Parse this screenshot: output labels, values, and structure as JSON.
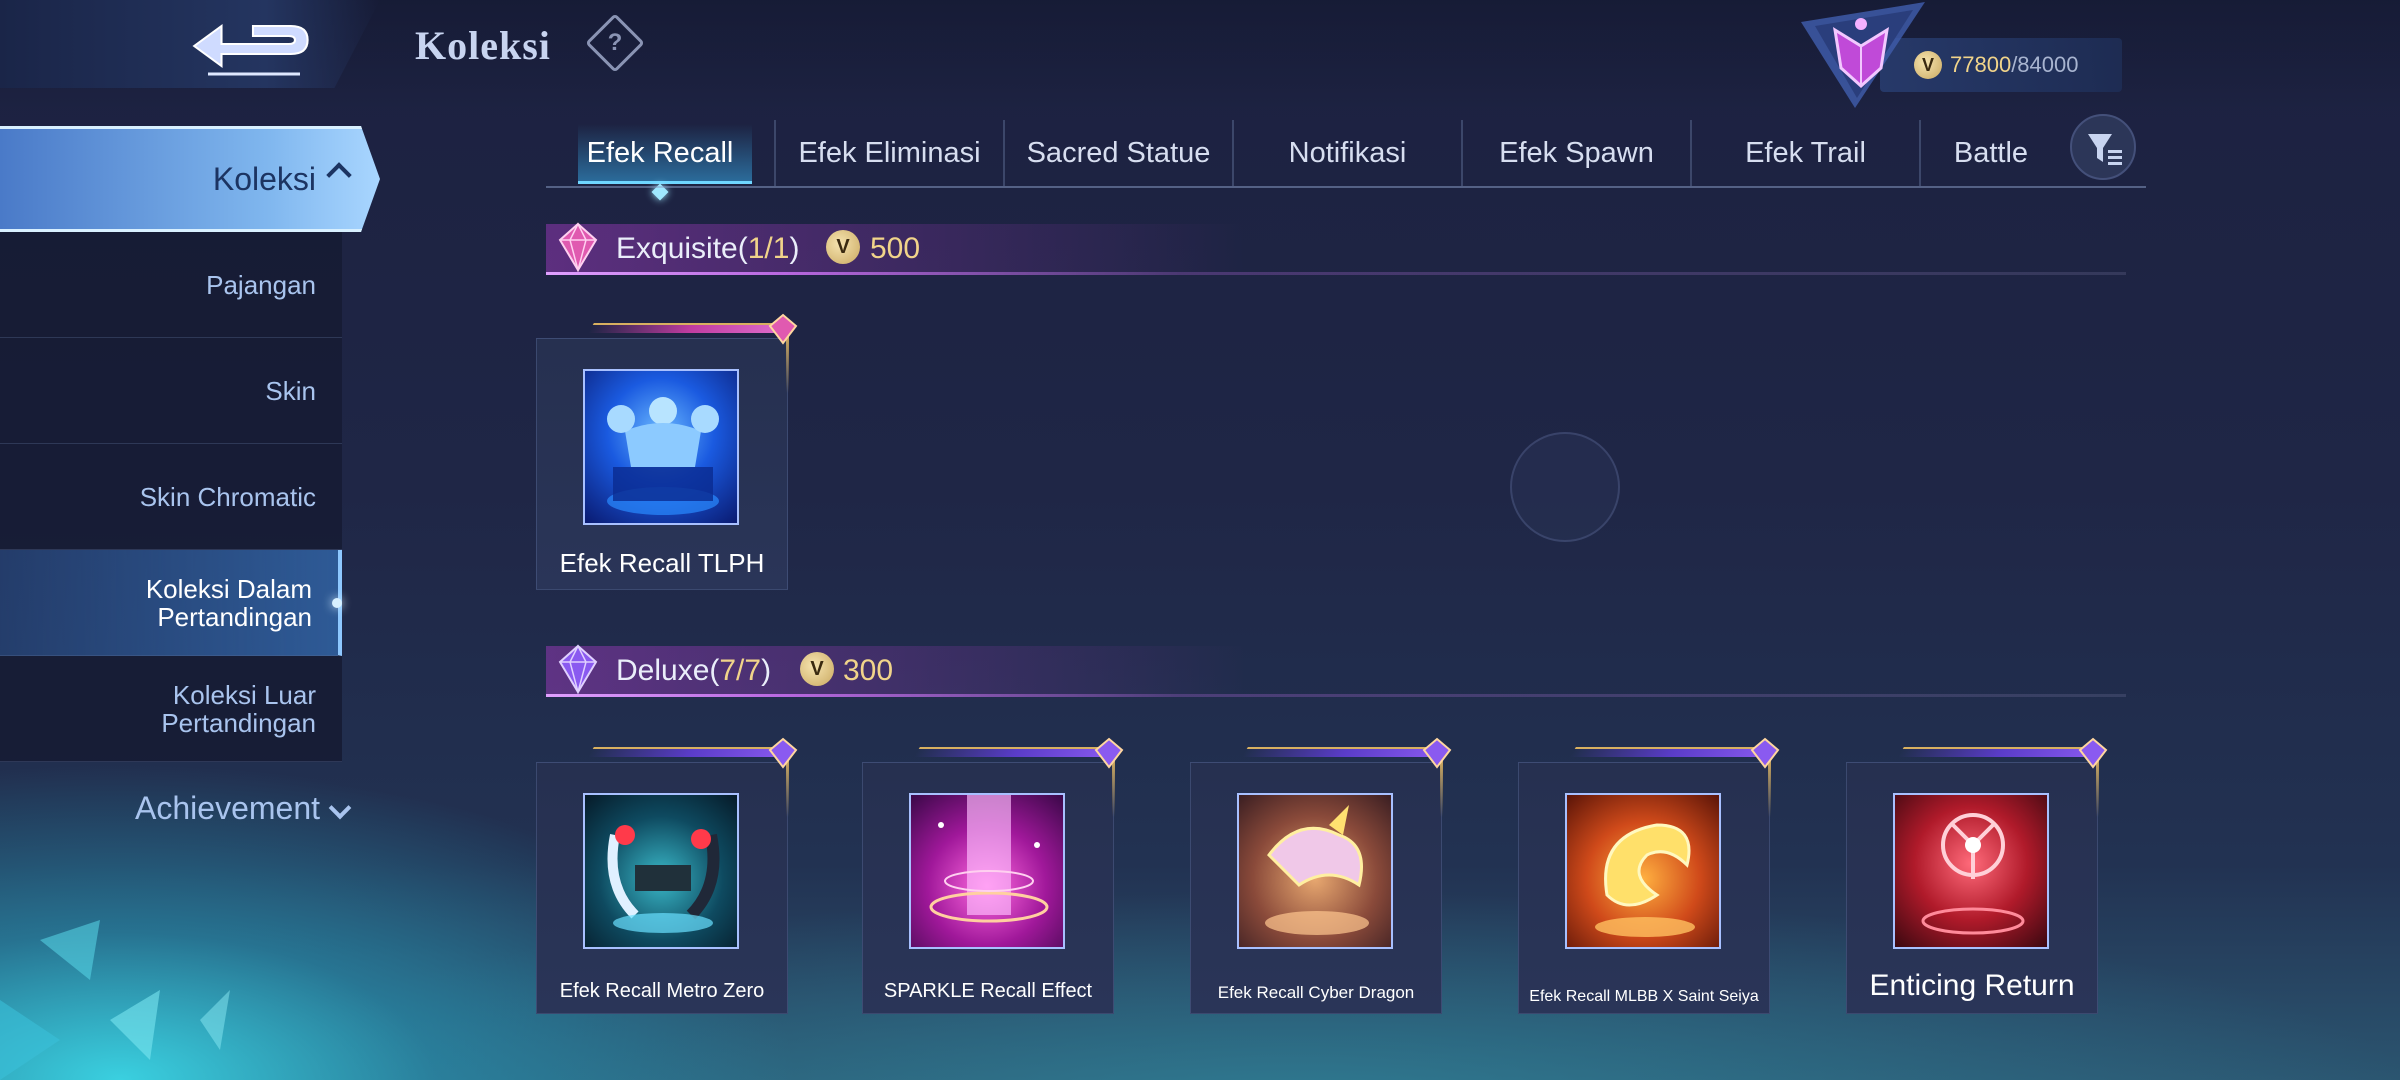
{
  "header": {
    "title": "Koleksi",
    "help_glyph": "?",
    "currency": {
      "icon": "coin-icon",
      "glyph": "V",
      "value": "77800",
      "max": "/84000"
    }
  },
  "sidebar": {
    "main_label": "Koleksi",
    "items": [
      {
        "label": "Pajangan"
      },
      {
        "label": "Skin"
      },
      {
        "label": "Skin Chromatic"
      },
      {
        "label": "Koleksi Dalam Pertandingan",
        "active": true
      },
      {
        "label": "Koleksi Luar Pertandingan"
      }
    ],
    "achievement_label": "Achievement"
  },
  "tabs": [
    {
      "label": "Efek Recall",
      "active": true
    },
    {
      "label": "Efek Eliminasi"
    },
    {
      "label": "Sacred Statue"
    },
    {
      "label": "Notifikasi"
    },
    {
      "label": "Efek Spawn"
    },
    {
      "label": "Efek Trail"
    },
    {
      "label": "Battle"
    }
  ],
  "sections": {
    "exquisite": {
      "title": "Exquisite(",
      "count": "1/1",
      "close": ")",
      "price": "500",
      "items": [
        {
          "label": "Efek Recall TLPH"
        }
      ]
    },
    "deluxe": {
      "title": "Deluxe(",
      "count": "7/7",
      "close": ")",
      "price": "300",
      "items": [
        {
          "label": "Efek Recall Metro Zero"
        },
        {
          "label": "SPARKLE Recall Effect"
        },
        {
          "label": "Efek Recall Cyber Dragon"
        },
        {
          "label": "Efek Recall MLBB X Saint Seiya"
        },
        {
          "label": "Enticing Return"
        }
      ]
    }
  },
  "colors": {
    "accent_gold": "#f1d48a",
    "exquisite_gem": "#e05ab0",
    "deluxe_gem": "#8a5af0",
    "active_tab_line": "#6fd6ff"
  }
}
